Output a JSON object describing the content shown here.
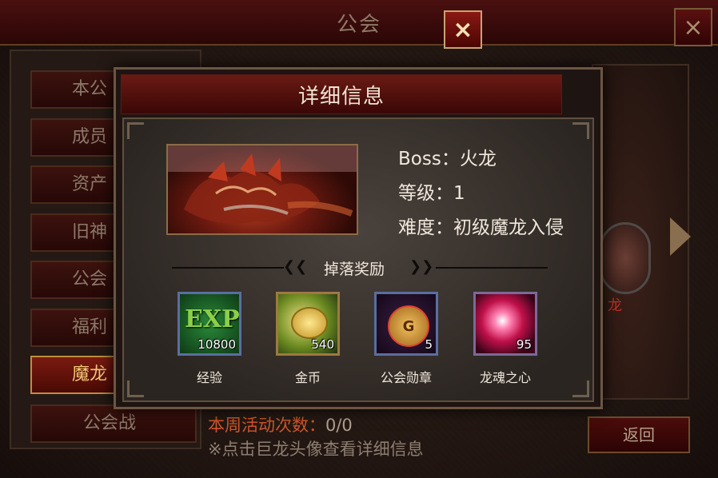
{
  "background": {
    "title": "公会",
    "close_icon": "×",
    "sidebar_items": [
      {
        "label": "本公"
      },
      {
        "label": "成员"
      },
      {
        "label": "资产"
      },
      {
        "label": "旧神"
      },
      {
        "label": "公会"
      },
      {
        "label": "福利"
      },
      {
        "label": "魔龙",
        "active": true
      },
      {
        "label": "公会战"
      }
    ],
    "dragon_name": "龙",
    "activity_label": "本周活动次数：",
    "activity_value": "0/0",
    "hint": "※点击巨龙头像查看详细信息",
    "return_label": "返回"
  },
  "dialog": {
    "title": "详细信息",
    "close_icon": "×",
    "boss_label": "Boss：火龙",
    "level_label": "等级：1",
    "difficulty_label": "难度：初级魔龙入侵",
    "drops_title": "掉落奖励",
    "rewards": [
      {
        "icon": "exp-icon",
        "icon_text": "EXP",
        "quantity": "10800",
        "name": "经验"
      },
      {
        "icon": "gold-coin-icon",
        "quantity": "540",
        "name": "金币"
      },
      {
        "icon": "guild-medal-icon",
        "icon_text": "G",
        "quantity": "5",
        "name": "公会勋章"
      },
      {
        "icon": "dragon-soul-icon",
        "quantity": "95",
        "name": "龙魂之心"
      }
    ]
  },
  "colors": {
    "accent_gold": "#c9a272",
    "title_red": "#6a1a14",
    "activity_orange": "#d0562a"
  }
}
